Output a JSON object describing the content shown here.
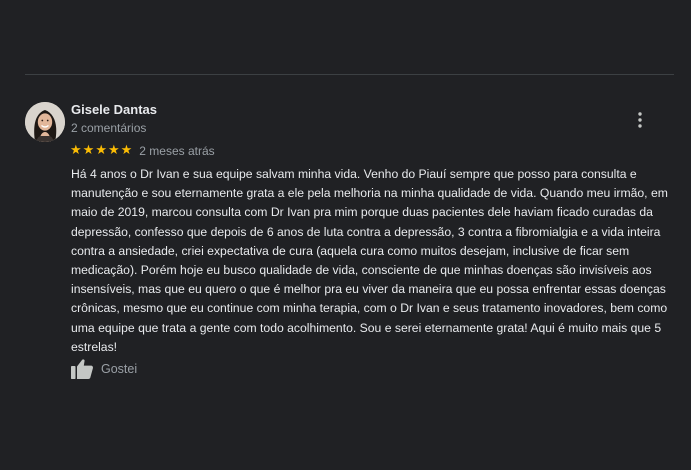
{
  "review": {
    "author": {
      "name": "Gisele Dantas",
      "meta": "2 comentários",
      "avatar": "profile-photo"
    },
    "rating": {
      "value": 5,
      "max": 5,
      "stars": [
        "★",
        "★",
        "★",
        "★",
        "★"
      ],
      "icon": "star-icon"
    },
    "time_ago": "2 meses atrás",
    "text": "Há 4 anos o Dr Ivan e sua equipe salvam minha vida. Venho do Piauí sempre que posso para consulta e manutenção e sou eternamente grata a ele pela melhoria na minha qualidade de vida. Quando meu irmão, em maio de 2019, marcou consulta com Dr Ivan pra mim porque duas pacientes dele haviam ficado curadas da depressão, confesso que depois de 6 anos de luta contra a depressão, 3 contra a fibromialgia e a vida inteira contra a ansiedade, criei expectativa de cura (aquela cura como muitos desejam, inclusive de ficar sem medicação). Porém hoje eu busco qualidade de vida, consciente de que minhas doenças são invisíveis aos insensíveis, mas que eu quero o que é melhor pra eu viver da maneira que eu possa enfrentar essas doenças crônicas, mesmo que eu continue com minha terapia, com o Dr Ivan e seus tratamento inovadores, bem como uma equipe que trata a gente com todo acolhimento. Sou e serei eternamente grata! Aqui é muito mais que 5 estrelas!",
    "like_label": "Gostei",
    "like_icon": "thumbs-up-icon",
    "menu_icon": "more-vert-icon"
  },
  "colors": {
    "background": "#202124",
    "primary_text": "#e8eaed",
    "secondary_text": "#9aa0a6",
    "star": "#fbbc04",
    "divider": "#3c4043"
  }
}
